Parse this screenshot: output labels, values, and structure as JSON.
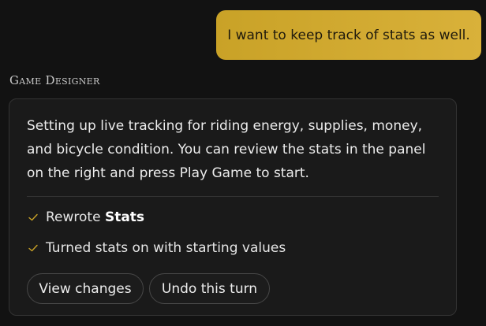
{
  "conversation": {
    "user_message": "I want to keep track of stats as well.",
    "assistant": {
      "sender": "Game Designer",
      "message": "Setting up live tracking for riding energy, supplies, money, and bicycle condition. You can review the stats in the panel on the right and press Play Game to start.",
      "changes": [
        {
          "prefix": "Rewrote ",
          "bold": "Stats"
        },
        {
          "text": "Turned stats on with starting values"
        }
      ],
      "actions": {
        "view_changes": "View changes",
        "undo_turn": "Undo this turn"
      }
    }
  },
  "colors": {
    "accent": "#d4ac33",
    "check": "#c9a227",
    "background": "#121212",
    "card": "#1a1a1a"
  },
  "icons": {
    "change_marker": "check-icon"
  }
}
